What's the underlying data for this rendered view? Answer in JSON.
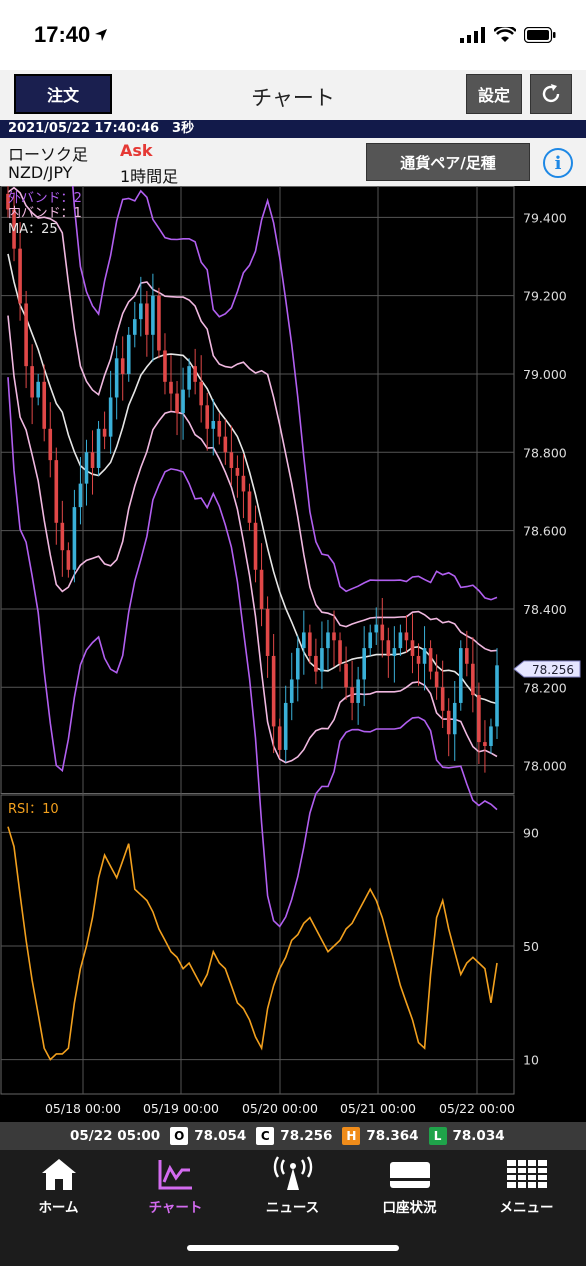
{
  "status_bar": {
    "time": "17:40"
  },
  "header": {
    "order_label": "注文",
    "title": "チャート",
    "settings_label": "設定"
  },
  "datetime": "2021/05/22 17:40:46　3秒",
  "info": {
    "chart_type": "ローソク足",
    "price_side": "Ask",
    "pair": "NZD/JPY",
    "timeframe": "1時間足",
    "pair_button": "通貨ペア/足種",
    "info_button": "i"
  },
  "legend": {
    "outer_band": "外バンド：2",
    "inner_band": "内バンド：1",
    "ma": "MA：25",
    "rsi": "RSI：10"
  },
  "current_price": "78.256",
  "ohlc": {
    "time": "05/22 05:00",
    "o_tag": "O",
    "o": "78.054",
    "c_tag": "C",
    "c": "78.256",
    "h_tag": "H",
    "h": "78.364",
    "l_tag": "L",
    "l": "78.034"
  },
  "tabs": [
    {
      "label": "ホーム",
      "icon": "home-icon"
    },
    {
      "label": "チャート",
      "icon": "chart-icon"
    },
    {
      "label": "ニュース",
      "icon": "news-icon"
    },
    {
      "label": "口座状況",
      "icon": "account-icon"
    },
    {
      "label": "メニュー",
      "icon": "menu-icon"
    }
  ],
  "colors": {
    "bull": "#3ab0d8",
    "bear": "#e04848",
    "outer_band": "#b15ff0",
    "inner_band": "#f0b8e0",
    "ma": "#e6e6e6",
    "rsi": "#f2a01e",
    "active_tab": "#d36bf0"
  },
  "chart_data": {
    "type": "candlestick",
    "symbol": "NZD/JPY",
    "timeframe": "1時間足",
    "y_ticks": [
      "79.400",
      "79.200",
      "79.000",
      "78.800",
      "78.600",
      "78.400",
      "78.200",
      "78.000"
    ],
    "ylim": [
      77.93,
      79.48
    ],
    "x_ticks": [
      "05/18 00:00",
      "05/19 00:00",
      "05/20 00:00",
      "05/21 00:00",
      "05/22 00:00"
    ],
    "rsi_ticks": [
      "90",
      "50",
      "10"
    ],
    "close_path": [
      79.42,
      79.32,
      79.18,
      79.02,
      78.94,
      78.98,
      78.86,
      78.78,
      78.62,
      78.55,
      78.5,
      78.66,
      78.72,
      78.8,
      78.76,
      78.86,
      78.84,
      78.94,
      79.04,
      79.0,
      79.1,
      79.14,
      79.18,
      79.1,
      79.2,
      79.06,
      78.98,
      78.95,
      78.9,
      78.96,
      79.02,
      78.98,
      78.92,
      78.86,
      78.88,
      78.84,
      78.8,
      78.76,
      78.74,
      78.7,
      78.62,
      78.5,
      78.4,
      78.28,
      78.1,
      78.04,
      78.16,
      78.22,
      78.3,
      78.34,
      78.28,
      78.24,
      78.3,
      78.34,
      78.32,
      78.26,
      78.2,
      78.16,
      78.22,
      78.3,
      78.34,
      78.36,
      78.32,
      78.28,
      78.3,
      78.34,
      78.32,
      78.28,
      78.26,
      78.3,
      78.24,
      78.2,
      78.14,
      78.08,
      78.16,
      78.3,
      78.26,
      78.18,
      78.06,
      78.05,
      78.1,
      78.256
    ],
    "rsi_path": [
      92,
      85,
      68,
      52,
      38,
      26,
      14,
      10,
      12,
      12,
      14,
      30,
      42,
      50,
      60,
      74,
      82,
      78,
      74,
      80,
      86,
      70,
      68,
      66,
      62,
      56,
      52,
      48,
      46,
      42,
      44,
      40,
      36,
      40,
      48,
      44,
      42,
      36,
      30,
      28,
      24,
      18,
      14,
      28,
      36,
      42,
      46,
      52,
      54,
      58,
      60,
      56,
      52,
      48,
      50,
      52,
      56,
      58,
      62,
      66,
      70,
      66,
      60,
      52,
      44,
      36,
      30,
      24,
      16,
      14,
      40,
      60,
      66,
      56,
      48,
      40,
      44,
      46,
      44,
      42,
      30,
      44
    ],
    "last_price": 78.256
  }
}
